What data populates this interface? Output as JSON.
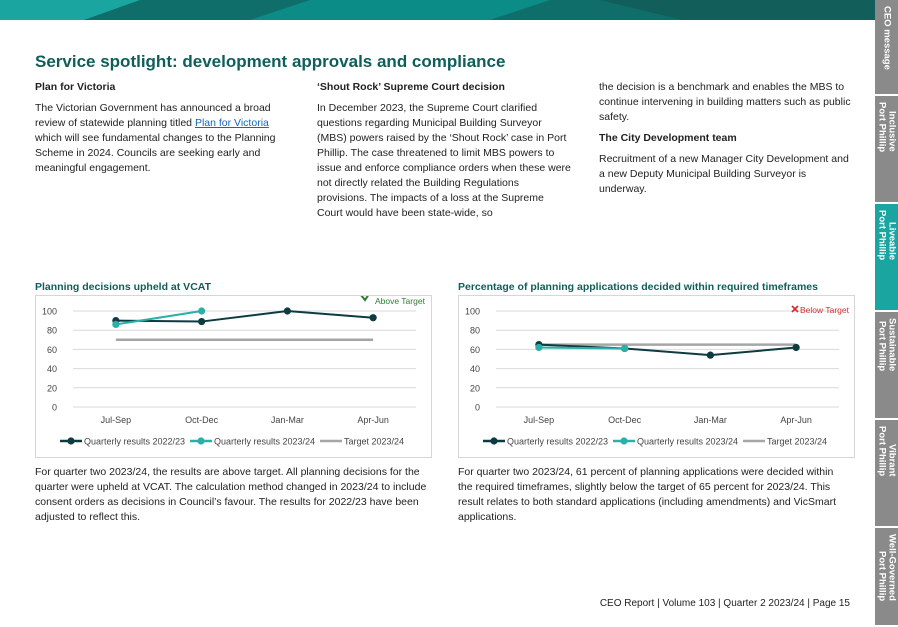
{
  "side_tabs": [
    {
      "label": "CEO message",
      "active": false
    },
    {
      "label": "Inclusive\nPort Phillip",
      "active": false
    },
    {
      "label": "Liveable\nPort Phillip",
      "active": true
    },
    {
      "label": "Sustainable\nPort Phillip",
      "active": false
    },
    {
      "label": "Vibrant\nPort Phillip",
      "active": false
    },
    {
      "label": "Well-Governed\nPort Phillip",
      "active": false
    }
  ],
  "page_title": "Service spotlight: development approvals and compliance",
  "col1": {
    "heading": "Plan for Victoria",
    "text_before": "The Victorian Government has announced a broad review of statewide planning titled ",
    "link": "Plan for Victoria",
    "text_after": " which will see fundamental changes to the Planning Scheme in 2024. Councils are seeking early and meaningful engagement."
  },
  "col2": {
    "heading": "‘Shout Rock’ Supreme Court decision",
    "text": "In December 2023, the Supreme Court clarified questions regarding Municipal Building Surveyor (MBS) powers raised by the ‘Shout Rock’ case in Port Phillip. The case threatened to limit MBS powers to issue and enforce compliance orders when these were not directly related the Building Regulations provisions. The impacts of a loss at the Supreme Court would have been state-wide, so"
  },
  "col3": {
    "text1": "the decision is a benchmark and enables the MBS to continue intervening in building matters such as public safety.",
    "heading": "The City Development team",
    "text2": "Recruitment of a new Manager City Development and a new Deputy Municipal Building Surveyor is underway."
  },
  "chart1": {
    "title": "Planning decisions upheld at VCAT",
    "status": "Above Target",
    "status_icon": "check-icon",
    "caption": "For quarter two 2023/24, the results are above target. All planning decisions for the quarter were upheld at VCAT. The calculation method changed in 2023/24 to include consent orders as decisions in Council’s favour. The results for 2022/23 have been adjusted to reflect this."
  },
  "chart2": {
    "title": "Percentage of planning applications decided within required timeframes",
    "status": "Below Target",
    "status_icon": "cross-icon",
    "caption": "For quarter two 2023/24, 61 percent of planning applications were decided within the required timeframes, slightly below the target of 65 percent for 2023/24. This result relates to both standard applications (including amendments) and VicSmart applications."
  },
  "colors": {
    "series_2022_23": "#0d3b3f",
    "series_2023_24": "#2ab0a8",
    "target": "#a6a6a6",
    "heading": "#0e5e5a",
    "above": "#2e7d32",
    "below": "#d32f2f"
  },
  "chart_data": [
    {
      "type": "line",
      "title": "Planning decisions upheld at VCAT",
      "categories": [
        "Jul-Sep",
        "Oct-Dec",
        "Jan-Mar",
        "Apr-Jun"
      ],
      "ylim": [
        0,
        100
      ],
      "yticks": [
        0,
        20,
        40,
        60,
        80,
        100
      ],
      "grid": true,
      "legend": "bottom",
      "series": [
        {
          "name": "Quarterly results 2022/23",
          "values": [
            90,
            89,
            100,
            93
          ]
        },
        {
          "name": "Quarterly results 2023/24",
          "values": [
            86,
            100,
            null,
            null
          ]
        },
        {
          "name": "Target 2023/24",
          "values": [
            70,
            70,
            70,
            70
          ]
        }
      ]
    },
    {
      "type": "line",
      "title": "Percentage of planning applications decided within required timeframes",
      "categories": [
        "Jul-Sep",
        "Oct-Dec",
        "Jan-Mar",
        "Apr-Jun"
      ],
      "ylim": [
        0,
        100
      ],
      "yticks": [
        0,
        20,
        40,
        60,
        80,
        100
      ],
      "grid": true,
      "legend": "bottom",
      "series": [
        {
          "name": "Quarterly results 2022/23",
          "values": [
            65,
            61,
            54,
            62
          ]
        },
        {
          "name": "Quarterly results 2023/24",
          "values": [
            62,
            61,
            null,
            null
          ]
        },
        {
          "name": "Target 2023/24",
          "values": [
            65,
            65,
            65,
            65
          ]
        }
      ]
    }
  ],
  "footer": "CEO Report | Volume 103 | Quarter 2 2023/24 | Page 15"
}
